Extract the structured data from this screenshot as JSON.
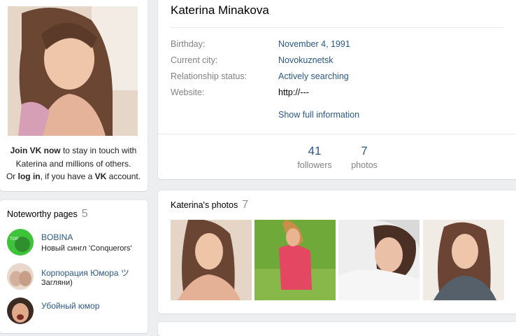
{
  "profile": {
    "name": "Katerina Minakova",
    "info": [
      {
        "label": "Birthday:",
        "value": "November 4, 1991"
      },
      {
        "label": "Current city:",
        "value": "Novokuznetsk"
      },
      {
        "label": "Relationship status:",
        "value": "Actively searching"
      },
      {
        "label": "Website:",
        "value": "http://---"
      }
    ],
    "show_full": "Show full information",
    "counters": [
      {
        "num": "41",
        "label": "followers"
      },
      {
        "num": "7",
        "label": "photos"
      }
    ]
  },
  "join": {
    "part1_bold": "Join VK now",
    "part2": " to stay in touch with Katerina and millions of others.",
    "part3": "Or ",
    "login_link": "log in",
    "part4": ", if you have a ",
    "vk_bold": "VK",
    "part5": " account."
  },
  "noteworthy": {
    "title": "Noteworthy pages",
    "count": "5",
    "pages": [
      {
        "name": "BOBINA",
        "desc": "Новый сингл 'Conquerors'",
        "thumb_color": "#3ec43a"
      },
      {
        "name": "Корпорация Юмора ツ",
        "desc": "Загляни)",
        "thumb_color": "#d9c2b3"
      },
      {
        "name": "Убойный юмор",
        "desc": "",
        "thumb_color": "#c9896d"
      }
    ]
  },
  "photos": {
    "title": "Katerina's photos",
    "count": "7"
  },
  "colors": {
    "link": "#2a5885",
    "label": "#828282",
    "background": "#edeef0"
  }
}
